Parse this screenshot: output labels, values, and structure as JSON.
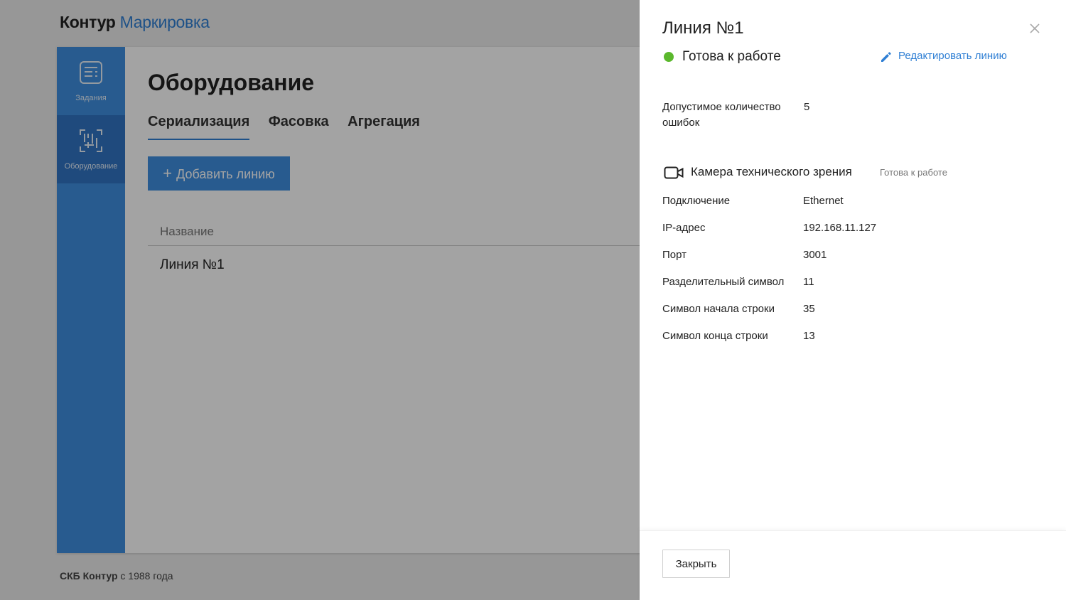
{
  "header": {
    "brand": "Контур",
    "product": "Маркировка"
  },
  "sidebar": {
    "items": [
      {
        "label": "Задания",
        "icon": "tasks-icon"
      },
      {
        "label": "Оборудование",
        "icon": "equipment-icon",
        "active": true
      }
    ]
  },
  "main": {
    "title": "Оборудование",
    "tabs": [
      {
        "label": "Сериализация",
        "active": true
      },
      {
        "label": "Фасовка"
      },
      {
        "label": "Агрегация"
      }
    ],
    "add_button": {
      "plus": "+",
      "label": "Добавить линию"
    },
    "table": {
      "column": "Название",
      "rows": [
        "Линия №1"
      ]
    }
  },
  "footer": {
    "company": "СКБ Контур",
    "since": " с 1988 года"
  },
  "panel": {
    "title": "Линия №1",
    "status": "Готова к работе",
    "status_color": "#5bb82d",
    "edit_link": "Редактировать линию",
    "errors_label": "Допустимое количество ошибок",
    "errors_value": "5",
    "device": {
      "name": "Камера технического зрения",
      "status": "Готова к работе",
      "icon": "camera-icon"
    },
    "properties": [
      {
        "key": "Подключение",
        "value": "Ethernet"
      },
      {
        "key": "IP-адрес",
        "value": "192.168.11.127"
      },
      {
        "key": "Порт",
        "value": "3001"
      },
      {
        "key": "Разделительный символ",
        "value": "11"
      },
      {
        "key": "Символ начала строки",
        "value": "35"
      },
      {
        "key": "Символ конца строки",
        "value": "13"
      }
    ],
    "close_button": "Закрыть"
  },
  "colors": {
    "accent": "#3f8fe0",
    "link": "#2f7fd4"
  }
}
